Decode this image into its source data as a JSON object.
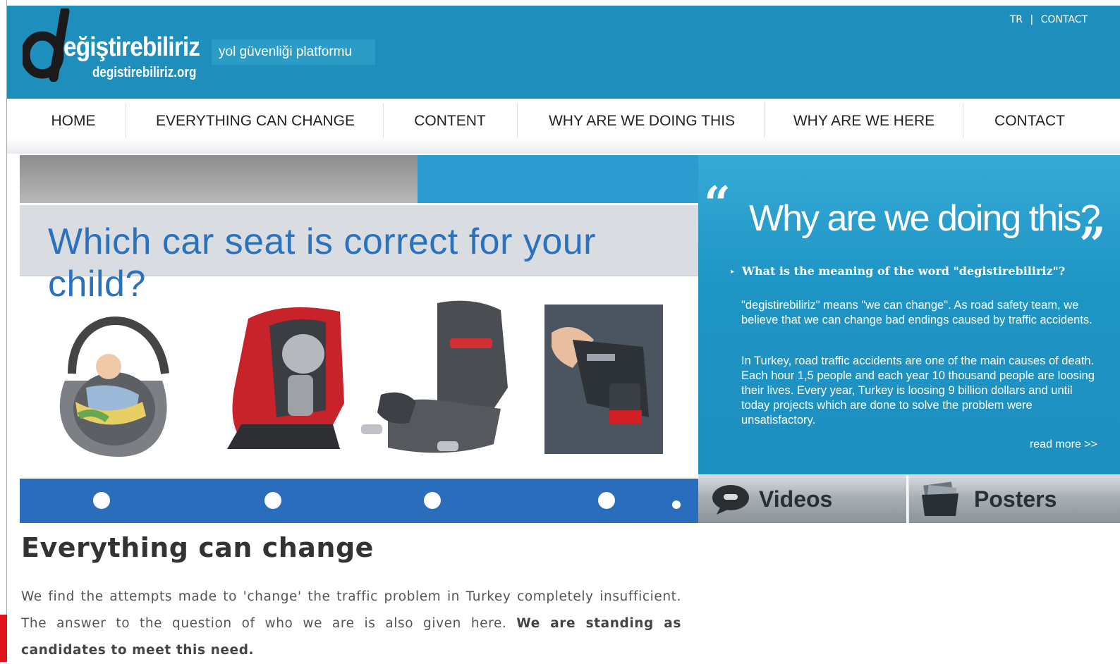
{
  "header": {
    "logo_name": "eğiştirebiliriz",
    "logo_url": "degistirebiliriz.org",
    "tagline": "yol güvenliği platformu",
    "lang": "TR",
    "lang_sep": "|",
    "contact_link": "CONTACT"
  },
  "nav": {
    "items": [
      {
        "label": "HOME"
      },
      {
        "label": "EVERYTHING CAN CHANGE"
      },
      {
        "label": "CONTENT"
      },
      {
        "label": "WHY ARE WE DOING THIS"
      },
      {
        "label": "WHY ARE WE HERE"
      },
      {
        "label": "CONTACT"
      }
    ]
  },
  "slider": {
    "title": "Which car seat is correct for your child?",
    "images": [
      "infant-carrier-seat",
      "convertible-car-seat",
      "booster-seat",
      "seat-belt-buckle"
    ]
  },
  "why_panel": {
    "open_quote": "“",
    "close_quote": "”",
    "title": "Why are we doing this?",
    "question": "What is the meaning of the word \"degistirebiliriz\"?",
    "para1": "\"degistirebiliriz\" means \"we can change\". As road safety team, we believe that we can change bad endings caused by traffic accidents.",
    "para2": "In Turkey, road traffic accidents are one of the main causes of death. Each hour 1,5 people and each year 10 thousand people are loosing their lives. Every year, Turkey is loosing 9 billion dollars and until today projects which are done to solve the problem were unsatisfactory.",
    "read_more": "read more >>"
  },
  "tiles": {
    "videos": "Videos",
    "posters": "Posters"
  },
  "content": {
    "title": "Everything can change",
    "text": "We find the attempts made to 'change' the traffic problem in Turkey completely insufficient. The answer to the question of who we are is also given here.",
    "bold": "We are standing as candidates to meet this need."
  },
  "colors": {
    "header_blue": "#1e8fbc",
    "slider_title_blue": "#2a72bd",
    "dots_bar_blue": "#2a6dbd"
  }
}
